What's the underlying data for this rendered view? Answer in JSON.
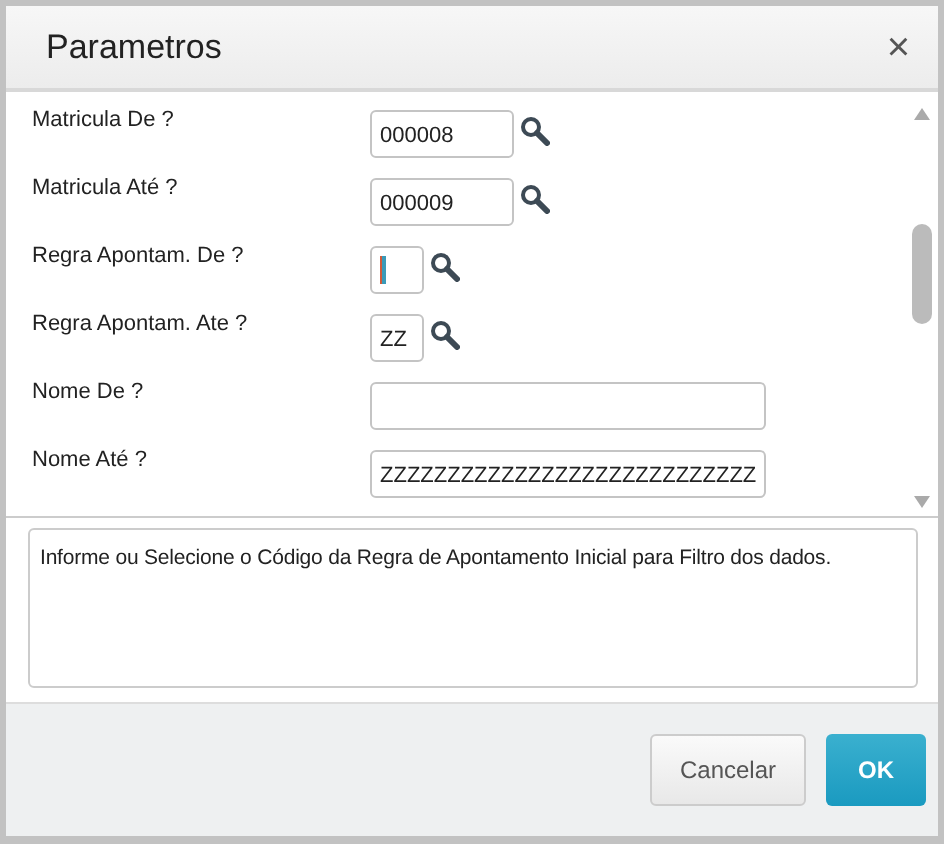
{
  "dialog": {
    "title": "Parametros",
    "close": "×"
  },
  "fields": [
    {
      "label": "Matricula De ?",
      "kind": "code",
      "value": "000008",
      "focused": false
    },
    {
      "label": "Matricula Até ?",
      "kind": "code",
      "value": "000009",
      "focused": false
    },
    {
      "label": "Regra Apontam. De ?",
      "kind": "tiny",
      "focused": true
    },
    {
      "label": "Regra Apontam. Ate ?",
      "kind": "tiny",
      "value": "ZZ",
      "focused": false
    },
    {
      "label": "Nome De ?",
      "kind": "text",
      "focused": false
    },
    {
      "label": "Nome Até ?",
      "kind": "text",
      "value": "ZZZZZZZZZZZZZZZZZZZZZZZZZZZZ",
      "focused": false
    }
  ],
  "help": "Informe ou Selecione o Código da Regra de Apontamento Inicial para Filtro dos dados.",
  "buttons": [
    {
      "label": "Cancelar",
      "kind": "secondary"
    },
    {
      "label": "OK",
      "kind": "primary"
    }
  ]
}
